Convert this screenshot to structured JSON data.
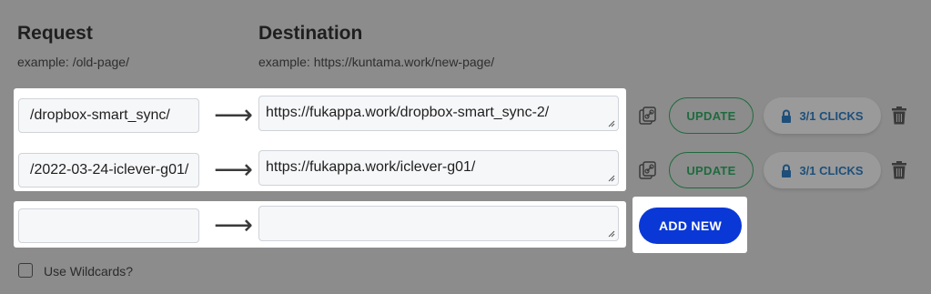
{
  "headers": {
    "request": {
      "title": "Request",
      "example": "example: /old-page/"
    },
    "destination": {
      "title": "Destination",
      "example": "example: https://kuntama.work/new-page/"
    }
  },
  "redirects": [
    {
      "request": "/dropbox-smart_sync/",
      "destination": "https://fukappa.work/dropbox-smart_sync-2/",
      "update_label": "UPDATE",
      "clicks_label": "3/1 CLICKS"
    },
    {
      "request": "/2022-03-24-iclever-g01/",
      "destination": "https://fukappa.work/iclever-g01/",
      "update_label": "UPDATE",
      "clicks_label": "3/1 CLICKS"
    }
  ],
  "new_redirect": {
    "request": "",
    "destination": "",
    "add_label": "ADD NEW"
  },
  "arrow_glyph": "⟶",
  "wildcards": {
    "label": "Use Wildcards?",
    "checked": false
  },
  "icons": {
    "link": "link-icon",
    "lock": "lock-icon",
    "trash": "trash-icon",
    "resize": "resize-handle-icon"
  },
  "colors": {
    "overlay_bg": "#8c8c8c",
    "accent_blue": "#0a38d6",
    "update_green": "#1e6b3e",
    "clicks_text": "#1d4f7a"
  }
}
